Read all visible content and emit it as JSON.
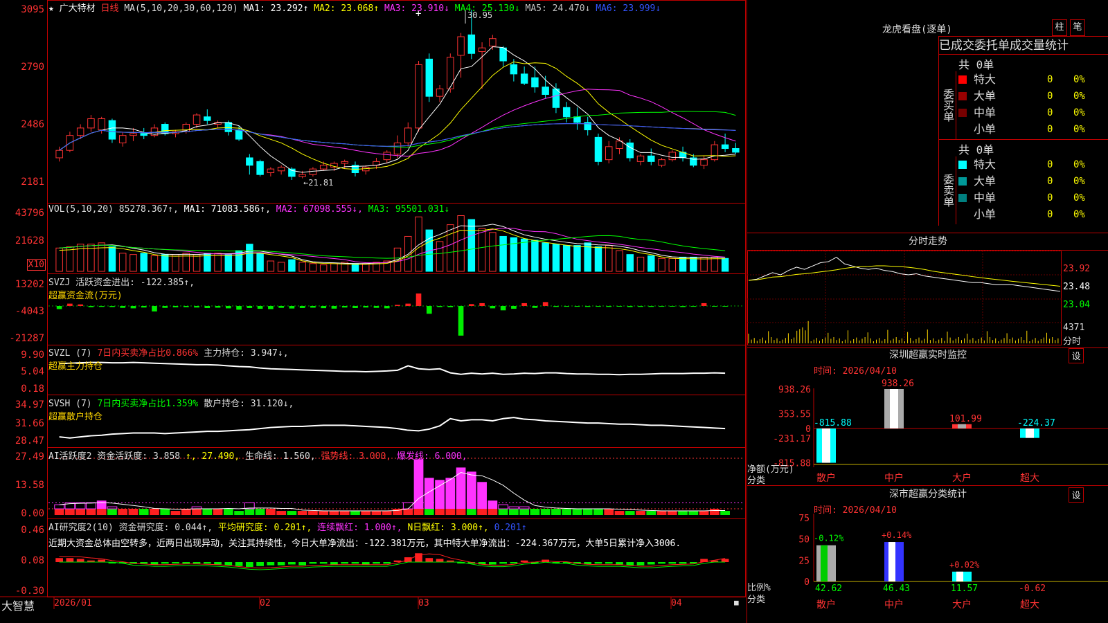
{
  "stock": {
    "name": "★ 广大特材",
    "period": "日线",
    "ma_title": "MA(5,10,20,30,60,120)",
    "ma_values": [
      {
        "label": "MA1: 23.292↑",
        "color": "#ffffff"
      },
      {
        "label": "MA2: 23.068↑",
        "color": "#ffff00"
      },
      {
        "label": "MA3: 23.910↓",
        "color": "#ff33ff"
      },
      {
        "label": "MA4: 25.130↓",
        "color": "#00ff00"
      },
      {
        "label": "MA5: 24.470↓",
        "color": "#c0c0c0"
      },
      {
        "label": "MA6: 23.999↓",
        "color": "#3355ff"
      }
    ],
    "price_axis": [
      "3095",
      "2790",
      "2486",
      "2181"
    ],
    "high_label": "30.95",
    "low_label": "←21.81"
  },
  "vol": {
    "title": "VOL(5,10,20) 85278.367↑,",
    "ma_values": [
      {
        "label": "MA1: 71083.586↑,",
        "color": "#ffffff"
      },
      {
        "label": "MA2: 67098.555↓,",
        "color": "#ff33ff"
      },
      {
        "label": "MA3: 95501.031↓",
        "color": "#00ff00"
      }
    ],
    "axis": [
      "43796",
      "21628"
    ],
    "unit": "X10"
  },
  "svzj": {
    "title": "SVZJ  活跃资金进出: -122.385↑,",
    "subtitle": "超赢资金流(万元)",
    "axis": [
      "13202",
      "-4043",
      "-21287"
    ]
  },
  "svzl": {
    "title": "SVZL (7)",
    "tag": "7日内买卖净占比0.866%",
    "extra": "主力持仓: 3.947↓,",
    "subtitle": "超赢主力持仓",
    "axis": [
      "9.90",
      "5.04",
      "0.18"
    ]
  },
  "svsh": {
    "title": "SVSH (7)",
    "tag": "7日内买卖净占比1.359%",
    "extra": "散户持仓: 31.120↓,",
    "subtitle": "超赢散户持仓",
    "axis": [
      "34.97",
      "31.66",
      "28.47"
    ]
  },
  "ai1": {
    "title": "AI活跃度2 资金活跃度: 3.858",
    "v2": "↑, 27.490,",
    "v3": "生命线: 1.560,",
    "v4": "强势线: 3.000,",
    "v5": "爆发线: 6.000,",
    "axis": [
      "27.49",
      "13.58",
      "0.00"
    ]
  },
  "ai2": {
    "title": "AI研究度2(10) 资金研究度: 0.044↑,",
    "v2": "平均研究度: 0.201↑,",
    "v3": "连续飘红: 1.000↑,",
    "v4": "N日飘红: 3.000↑,",
    "v5": "0.201↑",
    "note": "近期大资金总体由空转多，近两日出现异动，关注其持续性，今日大单净流出：-122.381万元，其中特大单净流出：-224.367万元，大单5日累计净入3006.",
    "axis": [
      "0.46",
      "0.08",
      "-0.30"
    ]
  },
  "footer": {
    "brand": "大智慧",
    "dates": [
      "2026/01",
      "02",
      "03",
      "04"
    ]
  },
  "dragon": {
    "title": "龙虎看盘(逐单)",
    "btn1": "柱",
    "btn2": "笔",
    "stat_title": "已成交委托单成交量统计",
    "buy_label": "委买单",
    "sell_label": "委卖单",
    "buy_total": "共 0单",
    "sell_total": "共 0单",
    "buy_rows": [
      {
        "name": "特大",
        "val": "0",
        "pct": "0%",
        "color": "#ff0000"
      },
      {
        "name": "大单",
        "val": "0",
        "pct": "0%",
        "color": "#990000"
      },
      {
        "name": "中单",
        "val": "0",
        "pct": "0%",
        "color": "#770000"
      },
      {
        "name": "小单",
        "val": "0",
        "pct": "0%",
        "color": "#000000"
      }
    ],
    "sell_rows": [
      {
        "name": "特大",
        "val": "0",
        "pct": "0%",
        "color": "#00ffff"
      },
      {
        "name": "大单",
        "val": "0",
        "pct": "0%",
        "color": "#009999"
      },
      {
        "name": "中单",
        "val": "0",
        "pct": "0%",
        "color": "#008080"
      },
      {
        "name": "小单",
        "val": "0",
        "pct": "0%",
        "color": "#000000"
      }
    ]
  },
  "intraday": {
    "title": "分时走势",
    "axis": [
      "23.92",
      "23.48",
      "23.04"
    ],
    "vol_axis": [
      "4371",
      "分时"
    ]
  },
  "sz_monitor": {
    "title": "深圳超赢实时监控",
    "btn": "设",
    "time": "时间: 2026/04/10",
    "ylabel1": "净额(万元)",
    "ylabel2": "分类",
    "axis": [
      "938.26",
      "353.55",
      "0",
      "-231.17",
      "-815.88"
    ]
  },
  "sz_class": {
    "title": "深市超赢分类统计",
    "btn": "设",
    "time": "时间: 2026/04/10",
    "ylabel1": "比例%",
    "ylabel2": "分类",
    "axis": [
      "75",
      "50",
      "25",
      "0"
    ]
  },
  "chart_data": [
    {
      "type": "candlestick",
      "title": "广大特材 日线",
      "x_ticks": [
        "2026/01",
        "02",
        "03",
        "04"
      ],
      "ylim": [
        21.81,
        30.95
      ],
      "annotations": {
        "high": 30.95,
        "low": 21.81
      },
      "candles": [
        {
          "o": 23.0,
          "h": 23.6,
          "c": 23.4,
          "l": 22.8
        },
        {
          "o": 23.4,
          "h": 24.4,
          "c": 24.2,
          "l": 23.3
        },
        {
          "o": 24.2,
          "h": 24.8,
          "c": 24.6,
          "l": 24.0
        },
        {
          "o": 24.6,
          "h": 25.3,
          "c": 25.1,
          "l": 24.4
        },
        {
          "o": 24.5,
          "h": 25.2,
          "c": 25.1,
          "l": 24.3
        },
        {
          "o": 25.0,
          "h": 25.1,
          "c": 24.0,
          "l": 23.8
        },
        {
          "o": 23.8,
          "h": 24.4,
          "c": 24.2,
          "l": 23.6
        },
        {
          "o": 24.2,
          "h": 24.6,
          "c": 24.3,
          "l": 23.9
        },
        {
          "o": 24.3,
          "h": 24.6,
          "c": 24.2,
          "l": 24.0
        },
        {
          "o": 24.2,
          "h": 24.8,
          "c": 24.6,
          "l": 24.1
        },
        {
          "o": 24.8,
          "h": 24.9,
          "c": 24.3,
          "l": 24.2
        },
        {
          "o": 24.3,
          "h": 24.5,
          "c": 24.4,
          "l": 24.1
        },
        {
          "o": 24.4,
          "h": 24.9,
          "c": 24.8,
          "l": 24.3
        },
        {
          "o": 24.8,
          "h": 25.4,
          "c": 25.3,
          "l": 24.6
        },
        {
          "o": 25.2,
          "h": 25.6,
          "c": 25.0,
          "l": 24.8
        },
        {
          "o": 24.8,
          "h": 25.0,
          "c": 24.9,
          "l": 24.6
        },
        {
          "o": 24.9,
          "h": 25.0,
          "c": 24.4,
          "l": 24.2
        },
        {
          "o": 24.5,
          "h": 24.7,
          "c": 24.0,
          "l": 23.9
        },
        {
          "o": 23.0,
          "h": 23.2,
          "c": 22.6,
          "l": 22.1
        },
        {
          "o": 22.8,
          "h": 22.9,
          "c": 22.1,
          "l": 22.0
        },
        {
          "o": 22.2,
          "h": 22.5,
          "c": 22.4,
          "l": 22.0
        },
        {
          "o": 22.3,
          "h": 22.6,
          "c": 22.5,
          "l": 22.1
        },
        {
          "o": 22.4,
          "h": 22.5,
          "c": 22.0,
          "l": 21.81
        },
        {
          "o": 22.0,
          "h": 22.3,
          "c": 22.1,
          "l": 21.9
        },
        {
          "o": 22.1,
          "h": 22.5,
          "c": 22.4,
          "l": 22.0
        },
        {
          "o": 22.4,
          "h": 22.8,
          "c": 22.6,
          "l": 22.3
        },
        {
          "o": 22.5,
          "h": 22.8,
          "c": 22.7,
          "l": 22.3
        },
        {
          "o": 22.7,
          "h": 22.9,
          "c": 22.8,
          "l": 22.4
        },
        {
          "o": 22.6,
          "h": 22.8,
          "c": 22.2,
          "l": 22.0
        },
        {
          "o": 22.3,
          "h": 22.6,
          "c": 22.5,
          "l": 22.1
        },
        {
          "o": 22.6,
          "h": 23.0,
          "c": 22.8,
          "l": 22.4
        },
        {
          "o": 22.9,
          "h": 23.4,
          "c": 23.3,
          "l": 22.7
        },
        {
          "o": 23.2,
          "h": 24.2,
          "c": 23.8,
          "l": 23.0
        },
        {
          "o": 23.8,
          "h": 24.9,
          "c": 24.6,
          "l": 23.6
        },
        {
          "o": 24.6,
          "h": 28.2,
          "c": 28.0,
          "l": 24.4
        },
        {
          "o": 28.3,
          "h": 28.6,
          "c": 26.3,
          "l": 26.0
        },
        {
          "o": 26.3,
          "h": 26.9,
          "c": 26.7,
          "l": 26.0
        },
        {
          "o": 26.7,
          "h": 28.6,
          "c": 28.4,
          "l": 26.5
        },
        {
          "o": 28.5,
          "h": 29.7,
          "c": 29.5,
          "l": 27.3
        },
        {
          "o": 29.6,
          "h": 30.95,
          "c": 28.6,
          "l": 28.3
        },
        {
          "o": 28.7,
          "h": 29.2,
          "c": 28.9,
          "l": 26.7
        },
        {
          "o": 29.0,
          "h": 29.6,
          "c": 29.4,
          "l": 28.8
        },
        {
          "o": 28.9,
          "h": 29.0,
          "c": 28.2,
          "l": 27.9
        },
        {
          "o": 28.0,
          "h": 28.3,
          "c": 27.5,
          "l": 27.1
        },
        {
          "o": 27.5,
          "h": 27.9,
          "c": 27.0,
          "l": 26.9
        },
        {
          "o": 27.3,
          "h": 27.9,
          "c": 26.8,
          "l": 26.5
        },
        {
          "o": 26.8,
          "h": 27.4,
          "c": 26.4,
          "l": 26.2
        },
        {
          "o": 26.7,
          "h": 27.0,
          "c": 25.7,
          "l": 25.4
        },
        {
          "o": 25.7,
          "h": 26.0,
          "c": 25.2,
          "l": 24.9
        },
        {
          "o": 25.2,
          "h": 25.7,
          "c": 24.9,
          "l": 24.5
        },
        {
          "o": 24.9,
          "h": 25.2,
          "c": 24.5,
          "l": 24.2
        },
        {
          "o": 24.1,
          "h": 24.3,
          "c": 22.8,
          "l": 22.6
        },
        {
          "o": 22.9,
          "h": 23.9,
          "c": 23.6,
          "l": 22.7
        },
        {
          "o": 23.5,
          "h": 24.1,
          "c": 23.9,
          "l": 23.2
        },
        {
          "o": 23.8,
          "h": 24.0,
          "c": 23.0,
          "l": 22.8
        },
        {
          "o": 22.8,
          "h": 23.2,
          "c": 23.1,
          "l": 22.6
        },
        {
          "o": 23.1,
          "h": 23.5,
          "c": 22.8,
          "l": 22.6
        },
        {
          "o": 22.6,
          "h": 23.0,
          "c": 22.9,
          "l": 22.5
        },
        {
          "o": 22.9,
          "h": 23.4,
          "c": 23.3,
          "l": 22.8
        },
        {
          "o": 23.3,
          "h": 23.6,
          "c": 23.0,
          "l": 22.8
        },
        {
          "o": 23.0,
          "h": 23.2,
          "c": 22.6,
          "l": 22.5
        },
        {
          "o": 22.6,
          "h": 23.1,
          "c": 22.9,
          "l": 22.4
        },
        {
          "o": 22.9,
          "h": 23.9,
          "c": 23.7,
          "l": 22.8
        },
        {
          "o": 23.7,
          "h": 24.3,
          "c": 23.5,
          "l": 23.3
        },
        {
          "o": 23.5,
          "h": 23.8,
          "c": 23.3,
          "l": 23.2
        }
      ]
    },
    {
      "type": "bar",
      "title": "VOL(5,10,20)",
      "ylim": [
        0,
        43796
      ],
      "values": [
        18000,
        19000,
        21000,
        21000,
        22000,
        19000,
        14000,
        13000,
        14000,
        12000,
        13000,
        13000,
        14000,
        13000,
        14000,
        14000,
        13000,
        16000,
        21000,
        14000,
        8000,
        7000,
        9000,
        7000,
        6000,
        5000,
        6000,
        7000,
        6000,
        6000,
        7000,
        8000,
        18000,
        27000,
        42000,
        32000,
        23000,
        36000,
        43000,
        40000,
        33000,
        30000,
        27000,
        26000,
        25000,
        24000,
        22000,
        21000,
        20000,
        20000,
        22000,
        19000,
        20000,
        16000,
        13000,
        11000,
        12000,
        10000,
        10000,
        11000,
        11000,
        11000,
        11000,
        10000
      ]
    },
    {
      "type": "bar",
      "title": "超赢资金流(万元)",
      "ylim": [
        -21287,
        13202
      ],
      "values": [
        -2000,
        1500,
        1000,
        -800,
        -600,
        -700,
        -1200,
        -1500,
        -1000,
        -3500,
        -1200,
        -900,
        -800,
        -1000,
        -1300,
        -1100,
        -1500,
        -2400,
        -1300,
        -1800,
        -2000,
        -1200,
        -1600,
        -1300,
        -1100,
        -1400,
        -1700,
        -1000,
        -1300,
        -1000,
        -1200,
        -1500,
        700,
        1500,
        8000,
        -5000,
        -700,
        -800,
        -19000,
        1200,
        1800,
        -1500,
        -2800,
        -1800,
        1800,
        -1200,
        2500,
        -600,
        -500,
        -500,
        -600,
        -500,
        -600,
        -400,
        -700,
        -600,
        -600,
        -500,
        -400,
        -700,
        -500,
        1800,
        -300,
        -400
      ]
    },
    {
      "type": "line",
      "title": "超赢主力持仓",
      "ylim": [
        0.18,
        9.9
      ],
      "values": [
        7.8,
        7.9,
        8.0,
        8.1,
        8.1,
        8.0,
        8.0,
        8.1,
        8.0,
        7.9,
        7.8,
        7.7,
        7.6,
        7.5,
        7.5,
        7.4,
        7.2,
        7.0,
        6.9,
        6.6,
        6.4,
        6.3,
        6.2,
        6.1,
        6.0,
        5.9,
        5.8,
        5.7,
        5.7,
        5.6,
        5.7,
        5.8,
        6.0,
        7.2,
        6.4,
        6.2,
        6.4,
        5.3,
        4.9,
        5.2,
        5.0,
        5.2,
        4.9,
        5.0,
        5.2,
        5.1,
        5.3,
        5.3,
        5.1,
        5.0,
        5.0,
        4.9,
        4.9,
        4.8,
        4.9,
        4.9,
        5.0,
        5.1,
        5.1,
        5.1,
        5.2,
        5.2,
        5.3,
        5.2
      ]
    },
    {
      "type": "line",
      "title": "超赢散户持仓",
      "ylim": [
        28.47,
        34.97
      ],
      "values": [
        29.7,
        29.5,
        29.7,
        29.9,
        30.0,
        30.2,
        30.3,
        30.4,
        30.4,
        30.4,
        30.3,
        30.4,
        30.5,
        30.6,
        30.7,
        30.7,
        30.8,
        30.9,
        31.0,
        31.2,
        31.4,
        31.5,
        31.6,
        31.6,
        31.7,
        31.8,
        31.8,
        31.8,
        31.7,
        31.6,
        31.5,
        31.4,
        31.2,
        30.9,
        30.8,
        31.1,
        31.7,
        33.0,
        32.6,
        32.8,
        32.8,
        32.6,
        33.0,
        33.2,
        32.9,
        32.8,
        32.6,
        32.5,
        32.4,
        32.3,
        32.2,
        32.2,
        32.1,
        32.0,
        32.0,
        31.9,
        31.8,
        31.8,
        31.7,
        31.6,
        31.5,
        31.4,
        31.3,
        31.2
      ]
    },
    {
      "type": "bar",
      "title": "AI活跃度2 资金活跃度",
      "ylim": [
        0,
        27.49
      ],
      "values": [
        5,
        6,
        6,
        6,
        7,
        4,
        3,
        3,
        3,
        3,
        3,
        2,
        3,
        4,
        3,
        3,
        3,
        2,
        6,
        3,
        3,
        2,
        2,
        2,
        2,
        2,
        2,
        2,
        2,
        2,
        2,
        2,
        3,
        6,
        27,
        18,
        17,
        18,
        23,
        21,
        16,
        7,
        5,
        4,
        4,
        3,
        3,
        3,
        3,
        3,
        3,
        3,
        3,
        2,
        2,
        2,
        2,
        2,
        2,
        2,
        2,
        2,
        3,
        2
      ],
      "magenta_threshold": 6
    },
    {
      "type": "bar",
      "title": "AI研究度2(10) 资金研究度",
      "ylim": [
        -0.3,
        0.46
      ],
      "values": [
        0.05,
        0.05,
        0.04,
        0.02,
        0.03,
        -0.01,
        -0.01,
        -0.02,
        -0.02,
        -0.03,
        -0.02,
        -0.01,
        -0.02,
        -0.02,
        -0.02,
        -0.03,
        -0.04,
        -0.05,
        -0.06,
        -0.05,
        -0.04,
        -0.04,
        -0.03,
        -0.04,
        -0.02,
        -0.02,
        -0.03,
        -0.02,
        -0.02,
        -0.03,
        -0.02,
        -0.02,
        0.02,
        0.06,
        0.11,
        0.05,
        0.04,
        0.02,
        -0.01,
        -0.02,
        -0.03,
        -0.03,
        -0.02,
        -0.01,
        0.02,
        -0.01,
        0.03,
        -0.01,
        -0.01,
        -0.02,
        -0.03,
        -0.02,
        -0.02,
        -0.03,
        -0.04,
        -0.04,
        -0.03,
        -0.02,
        -0.02,
        -0.02,
        -0.01,
        0.04,
        0.02,
        0.04
      ]
    },
    {
      "type": "line",
      "title": "分时走势",
      "ylim": [
        23.04,
        23.92
      ],
      "values": [
        23.48,
        23.5,
        23.56,
        23.62,
        23.58,
        23.66,
        23.72,
        23.68,
        23.74,
        23.8,
        23.82,
        23.9,
        23.78,
        23.74,
        23.7,
        23.68,
        23.7,
        23.66,
        23.64,
        23.6,
        23.58,
        23.6,
        23.56,
        23.54,
        23.52,
        23.5,
        23.48,
        23.46,
        23.44,
        23.44,
        23.42,
        23.4,
        23.4,
        23.4,
        23.38,
        23.36,
        23.34,
        23.32,
        23.3,
        23.28
      ]
    },
    {
      "type": "bar",
      "title": "深圳超赢实时监控",
      "categories": [
        "散户",
        "中户",
        "大户",
        "超大"
      ],
      "values": [
        -815.88,
        938.26,
        101.99,
        -224.37
      ],
      "ylim": [
        -815.88,
        938.26
      ]
    },
    {
      "type": "bar",
      "title": "深市超赢分类统计",
      "categories": [
        "散户",
        "中户",
        "大户",
        "超大"
      ],
      "values": [
        42.62,
        46.43,
        11.57,
        -0.62
      ],
      "changes": [
        "-0.12%",
        "+0.14%",
        "+0.02%",
        ""
      ],
      "ylim": [
        0,
        75
      ]
    }
  ]
}
